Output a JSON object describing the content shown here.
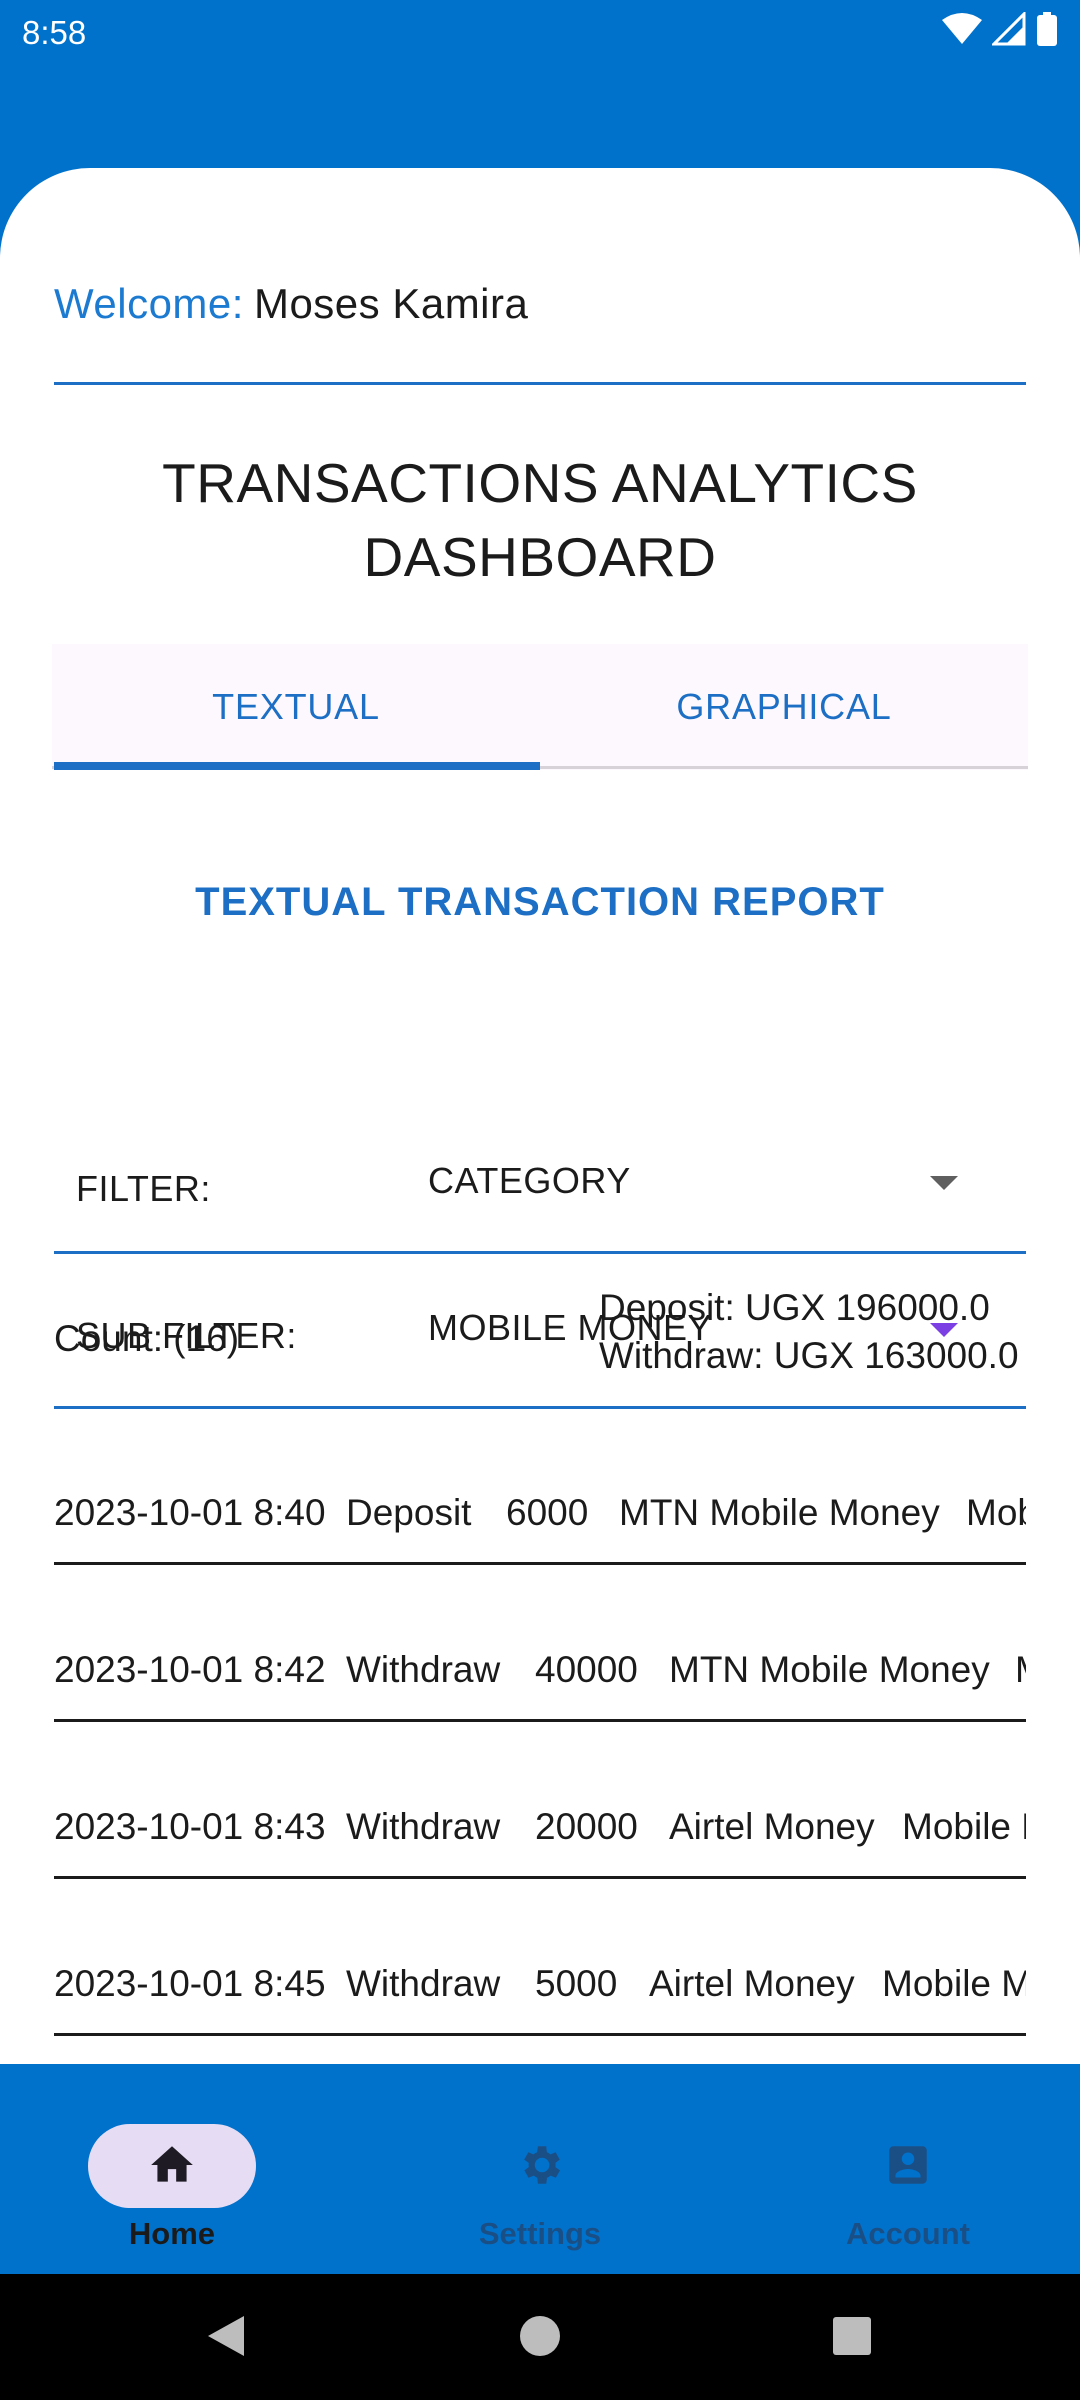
{
  "status": {
    "time": "8:58"
  },
  "welcome": {
    "label": "Welcome:",
    "name": "Moses Kamira"
  },
  "dashboard": {
    "title_line1": "TRANSACTIONS ANALYTICS",
    "title_line2": "DASHBOARD"
  },
  "tabs": [
    {
      "label": "TEXTUAL",
      "selected": true
    },
    {
      "label": "GRAPHICAL",
      "selected": false
    }
  ],
  "report": {
    "title": "TEXTUAL TRANSACTION REPORT"
  },
  "filters": {
    "filter_label": "FILTER:",
    "filter_value": "CATEGORY",
    "sub_filter_label": "SUB FILTER:",
    "sub_filter_value": "MOBILE MONEY"
  },
  "summary": {
    "count": "Count: (16)",
    "deposit": "Deposit: UGX 196000.0",
    "withdraw": "Withdraw: UGX 163000.0"
  },
  "transactions": [
    {
      "datetime": "2023-10-01 8:40",
      "type": "Deposit",
      "amount": "6000",
      "provider": "MTN Mobile Money",
      "category": "Mobile Money"
    },
    {
      "datetime": "2023-10-01 8:42",
      "type": "Withdraw",
      "amount": "40000",
      "provider": "MTN Mobile Money",
      "category": "Mobile Money"
    },
    {
      "datetime": "2023-10-01 8:43",
      "type": "Withdraw",
      "amount": "20000",
      "provider": "Airtel Money",
      "category": "Mobile Money"
    },
    {
      "datetime": "2023-10-01 8:45",
      "type": "Withdraw",
      "amount": "5000",
      "provider": "Airtel Money",
      "category": "Mobile Money"
    }
  ],
  "bottom_nav": [
    {
      "label": "Home",
      "icon": "home-icon",
      "active": true
    },
    {
      "label": "Settings",
      "icon": "gear-icon",
      "active": false
    },
    {
      "label": "Account",
      "icon": "account-icon",
      "active": false
    }
  ],
  "colors": {
    "primary": "#0072CC",
    "accent": "#1C6FC4",
    "pill": "#E6DDF5"
  }
}
